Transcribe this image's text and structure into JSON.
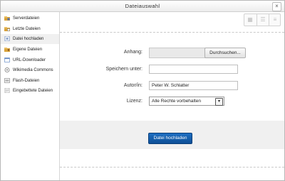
{
  "window": {
    "title": "Dateiauswahl",
    "close_glyph": "×"
  },
  "sidebar": {
    "items": [
      {
        "label": "Serverdateien",
        "icon": "server-files-icon",
        "color": "#d8a23a"
      },
      {
        "label": "Letzte Dateien",
        "icon": "recent-files-icon",
        "color": "#d8a23a"
      },
      {
        "label": "Datei hochladen",
        "icon": "upload-file-icon",
        "color": "#5b7db5",
        "active": true
      },
      {
        "label": "Eigene Dateien",
        "icon": "private-files-icon",
        "color": "#d8a23a"
      },
      {
        "label": "URL-Downloader",
        "icon": "url-downloader-icon",
        "color": "#6a8fc7"
      },
      {
        "label": "Wikimedia Commons",
        "icon": "wikimedia-icon",
        "color": "#777777"
      },
      {
        "label": "Flash-Dateien",
        "icon": "flash-files-icon",
        "color": "#888888"
      },
      {
        "label": "Eingebettete Dateien",
        "icon": "embedded-files-icon",
        "color": "#999999"
      }
    ]
  },
  "toolbar": {
    "views": [
      {
        "name": "icons",
        "glyph": "▦"
      },
      {
        "name": "details",
        "glyph": "☰"
      },
      {
        "name": "tree",
        "glyph": "≡"
      }
    ]
  },
  "form": {
    "attachment_label": "Anhang:",
    "browse_label": "Durchsuchen...",
    "save_as_label": "Speichern unter:",
    "save_as_value": "",
    "author_label": "Autor/in:",
    "author_value": "Peter W. Schlatter",
    "license_label": "Lizenz:",
    "license_value": "Alle Rechte vorbehalten",
    "license_arrow": "▾"
  },
  "footer": {
    "upload_label": "Datei hochladen"
  },
  "colors": {
    "accent": "#0e4f96",
    "active_item_bg": "#f0f0f0"
  }
}
